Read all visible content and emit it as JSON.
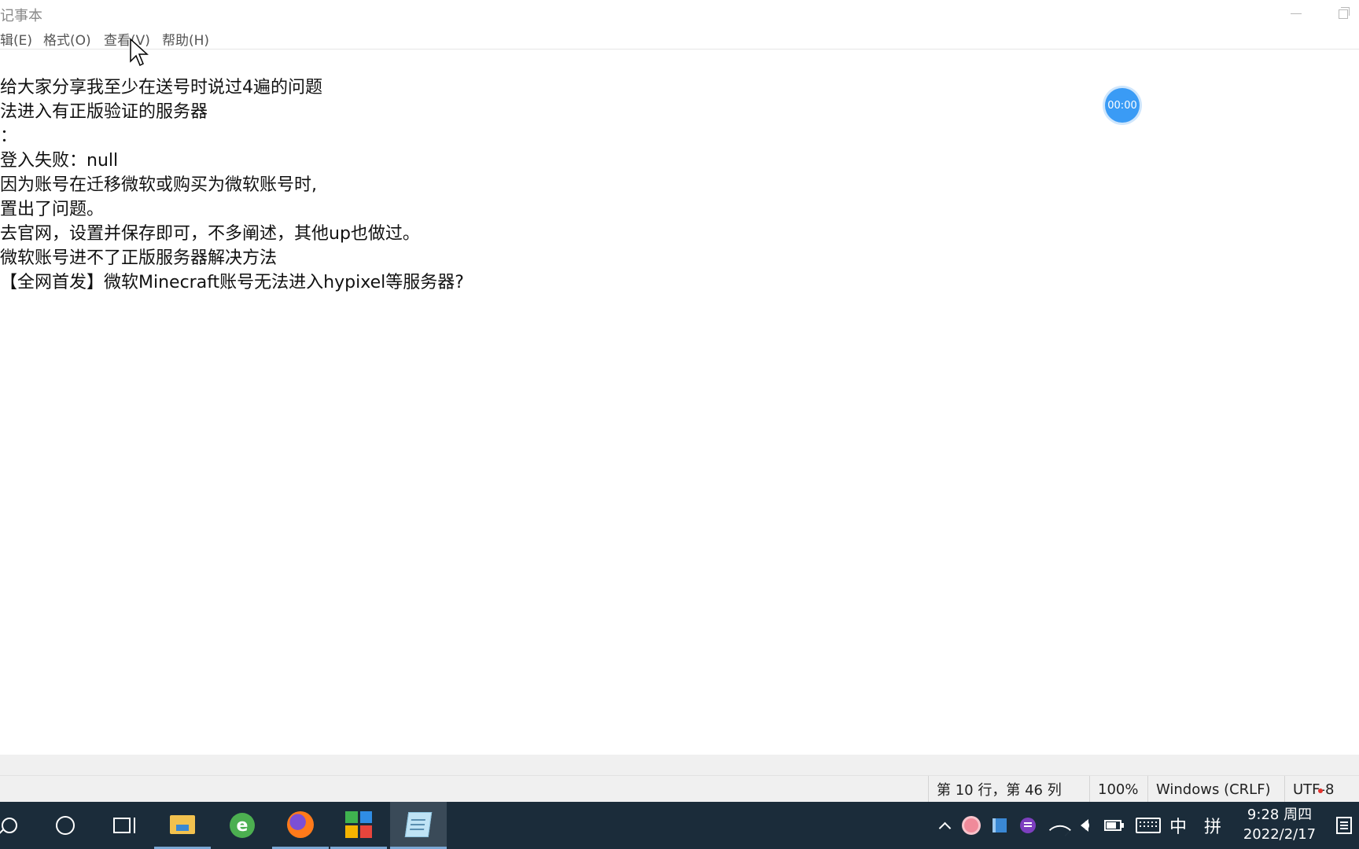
{
  "window": {
    "title": "记事本"
  },
  "menu": [
    {
      "id": "edit",
      "label": "辑(E)"
    },
    {
      "id": "format",
      "label": "格式(O)"
    },
    {
      "id": "view",
      "label": "查看(V)"
    },
    {
      "id": "help",
      "label": "帮助(H)"
    }
  ],
  "editor": {
    "lines": [
      "给大家分享我至少在送号时说过4遍的问题",
      "法进入有正版验证的服务器",
      "：",
      "登入失败：null",
      "因为账号在迁移微软或购买为微软账号时,",
      "置出了问题。",
      "去官网，设置并保存即可，不多阐述，其他up也做过。",
      "微软账号进不了正版服务器解决方法",
      "【全网首发】微软Minecraft账号无法进入hypixel等服务器?"
    ]
  },
  "timer": {
    "label": "00:00",
    "color": "#3a9bf5"
  },
  "status": {
    "position": "第 10 行，第 46 列",
    "zoom": "100%",
    "line_ending": "Windows (CRLF)",
    "encoding": "UTF-8"
  },
  "taskbar": {
    "apps": [
      {
        "name": "search-icon"
      },
      {
        "name": "cortana-icon"
      },
      {
        "name": "task-view-icon"
      },
      {
        "name": "file-explorer-icon",
        "running": true
      },
      {
        "name": "browser-e-icon",
        "running": false
      },
      {
        "name": "firefox-icon",
        "running": true
      },
      {
        "name": "tiles-app-icon",
        "running": true
      },
      {
        "name": "notepad-icon",
        "running": true,
        "active": true
      }
    ],
    "ie_glyph": "e",
    "ime_lang": "中",
    "ime_mode": "拼",
    "clock_time": "9:28 周四",
    "clock_date": "2022/2/17",
    "color": "#1b2c3a"
  }
}
